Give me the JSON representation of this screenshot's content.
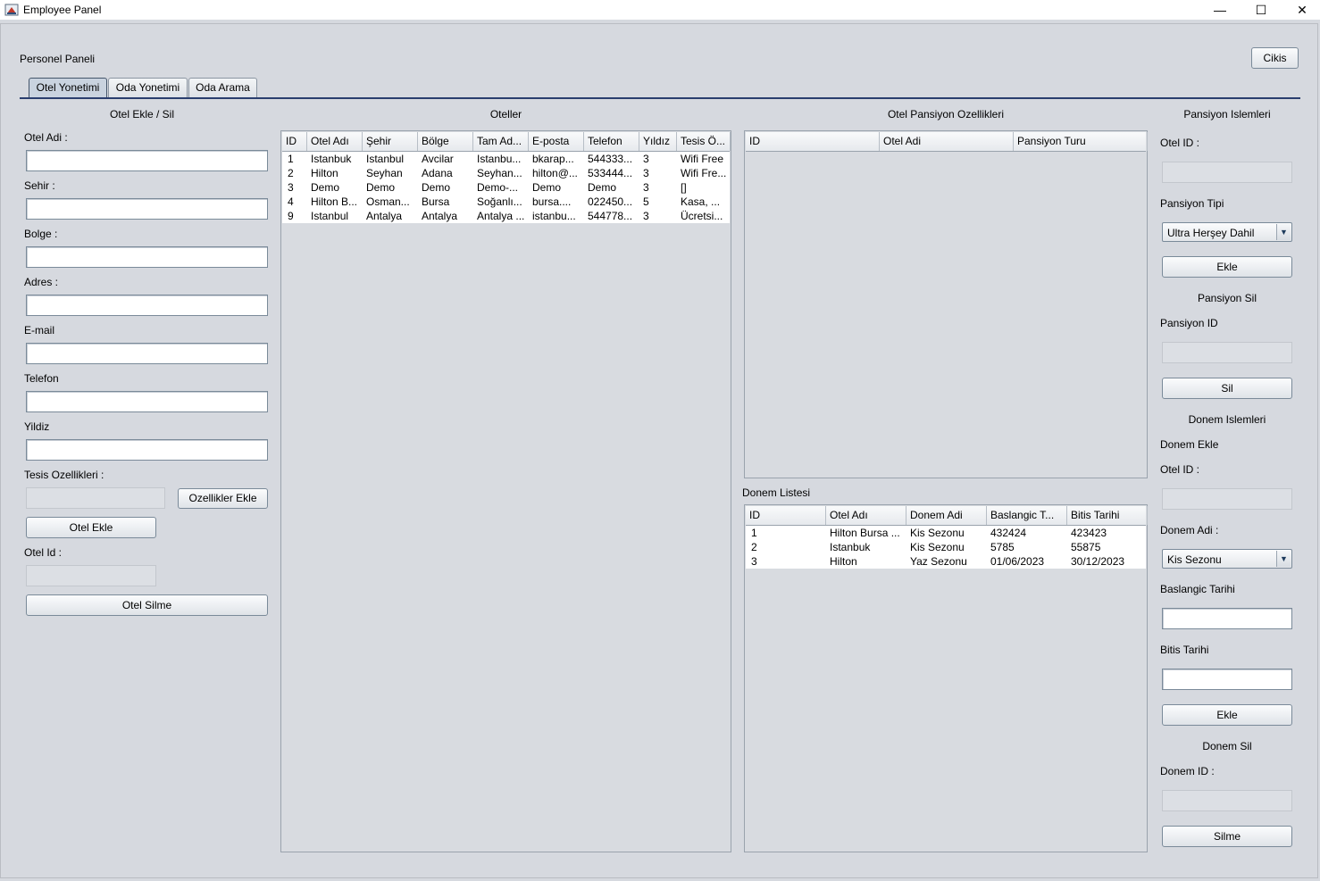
{
  "window": {
    "title": "Employee Panel",
    "minimize": "—",
    "maximize": "☐",
    "close": "✕"
  },
  "header": {
    "panel_title": "Personel Paneli",
    "logout_label": "Cikis"
  },
  "tabs": [
    {
      "label": "Otel Yonetimi",
      "active": true
    },
    {
      "label": "Oda Yonetimi",
      "active": false
    },
    {
      "label": "Oda Arama",
      "active": false
    }
  ],
  "hotel_form": {
    "section_title": "Otel Ekle / Sil",
    "name_label": "Otel Adi :",
    "city_label": "Sehir :",
    "region_label": "Bolge :",
    "address_label": "Adres :",
    "email_label": "E-mail",
    "phone_label": "Telefon",
    "stars_label": "Yildiz",
    "facilities_label": "Tesis Ozellikleri :",
    "add_features_button": "Ozellikler Ekle",
    "add_hotel_button": "Otel Ekle",
    "hotel_id_label": "Otel Id :",
    "delete_hotel_button": "Otel Silme"
  },
  "hotels_table": {
    "title": "Oteller",
    "columns": [
      "ID",
      "Otel Adı",
      "Şehir",
      "Bölge",
      "Tam Ad...",
      "E-posta",
      "Telefon",
      "Yıldız",
      "Tesis Ö..."
    ],
    "rows": [
      [
        "1",
        "Istanbuk",
        "Istanbul",
        "Avcilar",
        "Istanbu...",
        "bkarap...",
        "544333...",
        "3",
        "Wifi Free"
      ],
      [
        "2",
        "Hilton",
        "Seyhan",
        "Adana",
        "Seyhan...",
        "hilton@...",
        "533444...",
        "3",
        "Wifi Fre..."
      ],
      [
        "3",
        "Demo",
        "Demo",
        "Demo",
        "Demo-...",
        "Demo",
        "Demo",
        "3",
        "[]"
      ],
      [
        "4",
        "Hilton B...",
        "Osman...",
        "Bursa",
        "Soğanlı...",
        " bursa....",
        "022450...",
        "5",
        "Kasa, ..."
      ],
      [
        "9",
        "Istanbul",
        "Antalya",
        "Antalya",
        "Antalya ...",
        "istanbu...",
        "544778...",
        "3",
        "Ücretsi..."
      ]
    ]
  },
  "pension_table": {
    "title": "Otel Pansiyon Ozellikleri",
    "columns": [
      "ID",
      "Otel Adi",
      "Pansiyon Turu"
    ],
    "rows": []
  },
  "season_table": {
    "title": "Donem Listesi",
    "columns": [
      "ID",
      "Otel Adı",
      "Donem Adi",
      "Baslangic T...",
      "Bitis Tarihi"
    ],
    "rows": [
      [
        "1",
        "Hilton Bursa ...",
        "Kis Sezonu",
        "432424",
        "423423"
      ],
      [
        "2",
        "Istanbuk",
        "Kis Sezonu",
        "5785",
        "55875"
      ],
      [
        "3",
        "Hilton",
        "Yaz Sezonu",
        "01/06/2023",
        "30/12/2023"
      ]
    ]
  },
  "pension_ops": {
    "section_title": "Pansiyon Islemleri",
    "hotel_id_label": "Otel ID :",
    "type_label": "Pansiyon Tipi",
    "type_selected": "Ultra Herşey Dahil",
    "add_button": "Ekle",
    "delete_title": "Pansiyon Sil",
    "pension_id_label": "Pansiyon ID",
    "delete_button": "Sil"
  },
  "season_ops": {
    "section_title": "Donem Islemleri",
    "add_title": "Donem Ekle",
    "hotel_id_label": "Otel ID :",
    "name_label": "Donem Adi :",
    "name_selected": "Kis Sezonu",
    "start_label": "Baslangic Tarihi",
    "end_label": "Bitis Tarihi",
    "add_button": "Ekle",
    "delete_title": "Donem Sil",
    "season_id_label": "Donem ID :",
    "delete_button": "Silme"
  }
}
